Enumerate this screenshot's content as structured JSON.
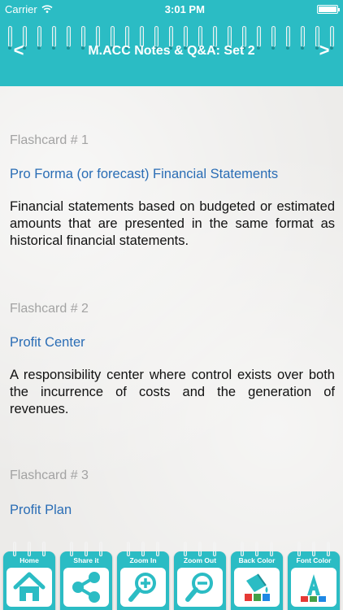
{
  "status_bar": {
    "carrier": "Carrier",
    "time": "3:01 PM",
    "battery_level": 1.0
  },
  "nav": {
    "title": "M.ACC Notes & Q&A: Set 2",
    "prev_icon": "chevron-left-icon",
    "next_icon": "chevron-right-icon"
  },
  "cards": [
    {
      "number": "Flashcard # 1",
      "term": "Pro Forma (or forecast) Financial Statements",
      "definition": "Financial statements based on budgeted or estimated amounts that are presented in the same format as historical financial statements."
    },
    {
      "number": "Flashcard # 2",
      "term": "Profit Center",
      "definition": "A responsibility center where control exists over both the incurrence of costs and the generation of revenues."
    },
    {
      "number": "Flashcard # 3",
      "term": "Profit Plan",
      "definition": ""
    }
  ],
  "toolbar": {
    "home": "Home",
    "share": "Share it",
    "zoom_in": "Zoom In",
    "zoom_out": "Zoom Out",
    "back_color": "Back Color",
    "font_color": "Font Color"
  },
  "colors": {
    "accent": "#2bbcc4",
    "term": "#2a6db5",
    "card_number": "#a3a3a3"
  }
}
